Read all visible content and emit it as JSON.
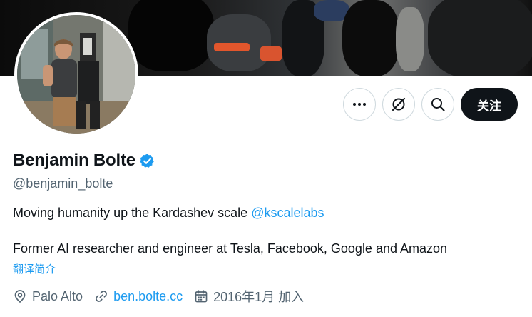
{
  "profile": {
    "display_name": "Benjamin Bolte",
    "handle": "@benjamin_bolte",
    "verified": true,
    "bio_line1_text": "Moving humanity up the Kardashev scale ",
    "bio_line1_mention": "@kscalelabs",
    "bio_line2": "Former AI researcher and engineer at Tesla, Facebook, Google and Amazon",
    "translate_label": "翻译简介",
    "location": "Palo Alto",
    "website": "ben.bolte.cc",
    "joined": "2016年1月 加入"
  },
  "actions": {
    "more_icon": "more-horizontal-icon",
    "grok_icon": "grok-slash-icon",
    "search_icon": "search-icon",
    "follow_label": "关注"
  },
  "colors": {
    "accent": "#1d9bf0",
    "text_primary": "#0f1419",
    "text_secondary": "#536471",
    "button_dark": "#0f1419",
    "border": "#cfd9de"
  }
}
